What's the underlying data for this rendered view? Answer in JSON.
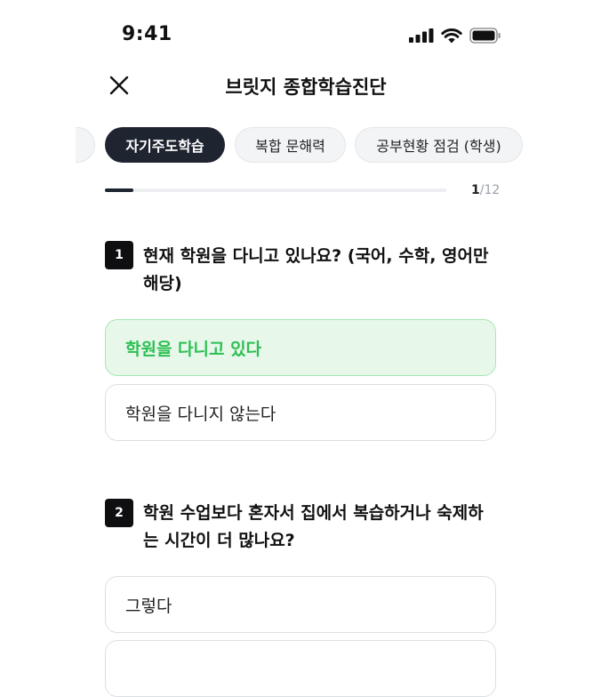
{
  "status_bar": {
    "time": "9:41",
    "icons": [
      "signal-icon",
      "wifi-icon",
      "battery-icon"
    ]
  },
  "header": {
    "title": "브릿지 종합학습진단",
    "close_icon": "close-icon"
  },
  "tabs": [
    {
      "label": "",
      "active": false
    },
    {
      "label": "자기주도학습",
      "active": true
    },
    {
      "label": "복합 문해력",
      "active": false
    },
    {
      "label": "공부현황 점검 (학생)",
      "active": false
    }
  ],
  "progress": {
    "current": "1",
    "separator": "/",
    "total": "12",
    "fraction": 0.083
  },
  "questions": [
    {
      "number": "1",
      "text": "현재 학원을 다니고 있나요? (국어, 수학, 영어만 해당)",
      "options": [
        {
          "label": "학원을 다니고 있다",
          "selected": true
        },
        {
          "label": "학원을 다니지 않는다",
          "selected": false
        }
      ]
    },
    {
      "number": "2",
      "text": "학원 수업보다 혼자서 집에서 복습하거나 숙제하는 시간이 더 많나요?",
      "options": [
        {
          "label": "그렇다",
          "selected": false
        },
        {
          "label": "",
          "selected": false
        }
      ]
    }
  ],
  "colors": {
    "dark": "#1f2431",
    "selected_bg": "#e7f8ea",
    "selected_border": "#a6e7b2",
    "selected_text": "#2dbf52"
  }
}
